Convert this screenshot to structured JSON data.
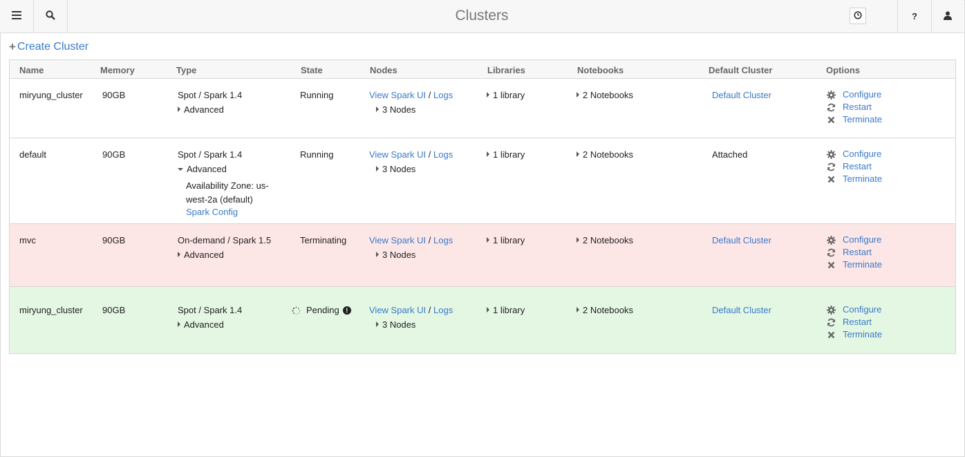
{
  "header": {
    "title": "Clusters",
    "menu_icon": "hamburger-menu-icon",
    "search_icon": "search-icon",
    "history_icon": "clock-icon",
    "help_label": "?",
    "user_icon": "user-icon"
  },
  "toolbar": {
    "create_label": "Create Cluster"
  },
  "table": {
    "columns": [
      "Name",
      "Memory",
      "Type",
      "State",
      "Nodes",
      "Libraries",
      "Notebooks",
      "Default Cluster",
      "Options"
    ],
    "rows": [
      {
        "name": "miryung_cluster",
        "memory": "90GB",
        "type": "Spot / Spark 1.4",
        "advanced_label": "Advanced",
        "state": "Running",
        "spark_ui_label": "View Spark UI",
        "separator": "/",
        "logs_label": "Logs",
        "nodes": "3 Nodes",
        "libraries": "1 library",
        "notebooks": "2 Notebooks",
        "default_cluster": "Default Cluster",
        "configure_label": "Configure",
        "restart_label": "Restart",
        "terminate_label": "Terminate"
      },
      {
        "name": "default",
        "memory": "90GB",
        "type": "Spot / Spark 1.4",
        "advanced_label": "Advanced",
        "advanced_detail_line1": "Availability Zone: us-",
        "advanced_detail_line2": "west-2a (default)",
        "spark_config_label": "Spark Config",
        "state": "Running",
        "spark_ui_label": "View Spark UI",
        "separator": "/",
        "logs_label": "Logs",
        "nodes": "3 Nodes",
        "libraries": "1 library",
        "notebooks": "2 Notebooks",
        "default_cluster": "Attached",
        "configure_label": "Configure",
        "restart_label": "Restart",
        "terminate_label": "Terminate"
      },
      {
        "name": "mvc",
        "memory": "90GB",
        "type": "On-demand / Spark 1.5",
        "advanced_label": "Advanced",
        "state": "Terminating",
        "spark_ui_label": "View Spark UI",
        "separator": "/",
        "logs_label": "Logs",
        "nodes": "3 Nodes",
        "libraries": "1 library",
        "notebooks": "2 Notebooks",
        "default_cluster": "Default Cluster",
        "configure_label": "Configure",
        "restart_label": "Restart",
        "terminate_label": "Terminate",
        "row_color": "#fde6e6"
      },
      {
        "name": "miryung_cluster",
        "memory": "90GB",
        "type": "Spot / Spark 1.4",
        "advanced_label": "Advanced",
        "state": "Pending",
        "spark_ui_label": "View Spark UI",
        "separator": "/",
        "logs_label": "Logs",
        "nodes": "3 Nodes",
        "libraries": "1 library",
        "notebooks": "2 Notebooks",
        "default_cluster": "Default Cluster",
        "configure_label": "Configure",
        "restart_label": "Restart",
        "terminate_label": "Terminate",
        "row_color": "#e3f7e3"
      }
    ]
  },
  "colors": {
    "link": "#3a7ac9",
    "terminating_row": "#fde6e6",
    "pending_row": "#e3f7e3"
  }
}
